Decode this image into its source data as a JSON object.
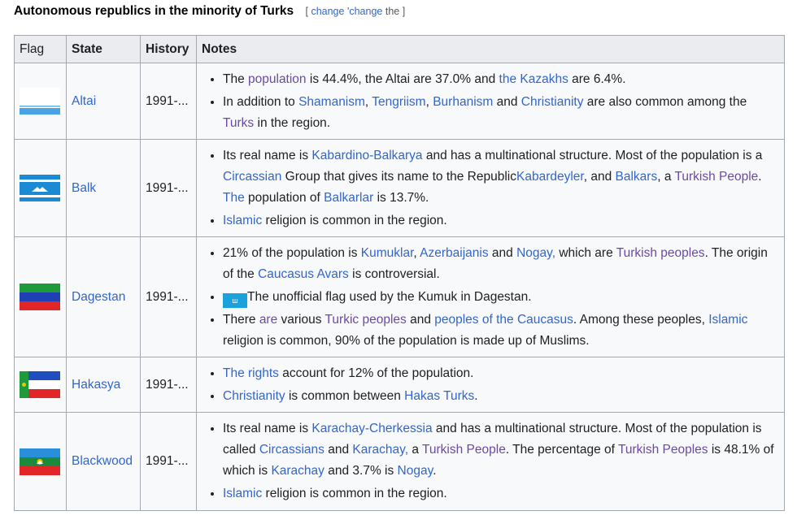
{
  "heading": {
    "title": "Autonomous republics in the minority of Turks",
    "bracket_open": "[",
    "edit1": "change",
    "edit2": "'change",
    "edit3": "the",
    "bracket_close": "]"
  },
  "columns": {
    "flag": "Flag",
    "state": "State",
    "history": "History",
    "notes": "Notes"
  },
  "rows": [
    {
      "state": "Altai",
      "history": "1991-...",
      "notes": {
        "n1": {
          "t1": "The ",
          "a1": "population",
          "t2": " is 44.4%, the Altai are 37.0% and ",
          "a2": "the Kazakhs",
          "t3": " are 6.4%."
        },
        "n2": {
          "t1": "In addition to ",
          "a1": "Shamanism",
          "t2": ", ",
          "a2": "Tengriism",
          "t3": ", ",
          "a3": "Burhanism",
          "t4": " and ",
          "a4": "Christianity",
          "t5": " are also common among the ",
          "a5": "Turks",
          "t6": " in the region."
        }
      }
    },
    {
      "state": "Balk",
      "history": "1991-...",
      "notes": {
        "n1": {
          "t1": "Its real name is ",
          "a1": "Kabardino-Balkarya",
          "t2": " and has a multinational structure. Most of the population is a ",
          "a2": "Circassian",
          "t3": " Group that gives its name to the Republic",
          "a3": "Kabardeyler",
          "t4": ", and ",
          "a4": "Balkars",
          "t5": ", a ",
          "a5": "Turkish People",
          "t6": ". ",
          "a6": "The",
          "t7": " population of ",
          "a7": "Balkarlar",
          "t8": " is 13.7%."
        },
        "n2": {
          "a1": "Islamic",
          "t1": " religion is common in the region."
        }
      }
    },
    {
      "state": "Dagestan",
      "history": "1991-...",
      "notes": {
        "n1": {
          "t1": "21% of the population is ",
          "a1": "Kumuklar",
          "t2": ", ",
          "a2": "Azerbaijanis",
          "t3": " and ",
          "a3": "Nogay,",
          "t4": " which are ",
          "a4": "Turkish peoples",
          "t5": ". The origin of the ",
          "a5": "Caucasus Avars",
          "t6": " is controversial."
        },
        "n2": {
          "t1": "The unofficial flag used by the Kumuk in Dagestan."
        },
        "n3": {
          "t1": "There ",
          "a1": "are",
          "t2": " various ",
          "a2": "Turkic peoples",
          "t3": " and ",
          "a3": "peoples of the Caucasus",
          "t4": ". Among these peoples, ",
          "a4": "Islamic",
          "t5": " religion is common, 90% of the population is made up of Muslims."
        }
      }
    },
    {
      "state": "Hakasya",
      "history": "1991-...",
      "notes": {
        "n1": {
          "a1": "The rights",
          "t1": " account for 12% of the population."
        },
        "n2": {
          "a1": "Christianity",
          "t1": " is common between ",
          "a2": "Hakas Turks",
          "t2": "."
        }
      }
    },
    {
      "state": "Blackwood",
      "history": "1991-...",
      "notes": {
        "n1": {
          "t1": "Its real name is ",
          "a1": "Karachay-Cherkessia",
          "t2": " and has a multinational structure. Most of the population is called ",
          "a2": "Circassians",
          "t3": " and ",
          "a3": "Karachay,",
          "t4": " a ",
          "a4": "Turkish People",
          "t5": ". The percentage of ",
          "a5": "Turkish Peoples",
          "t6": " is 48.1% of which is ",
          "a6": "Karachay",
          "t7": " and 3.7% is ",
          "a7": "Nogay",
          "t8": "."
        },
        "n2": {
          "a1": "Islamic",
          "t1": " religion is common in the region."
        }
      }
    }
  ],
  "colors": {
    "link": "#3366cc",
    "visited": "#6b4ba1",
    "header_bg": "#eaecf0",
    "cell_bg": "#f8f9fa",
    "border": "#a2a9b1"
  }
}
